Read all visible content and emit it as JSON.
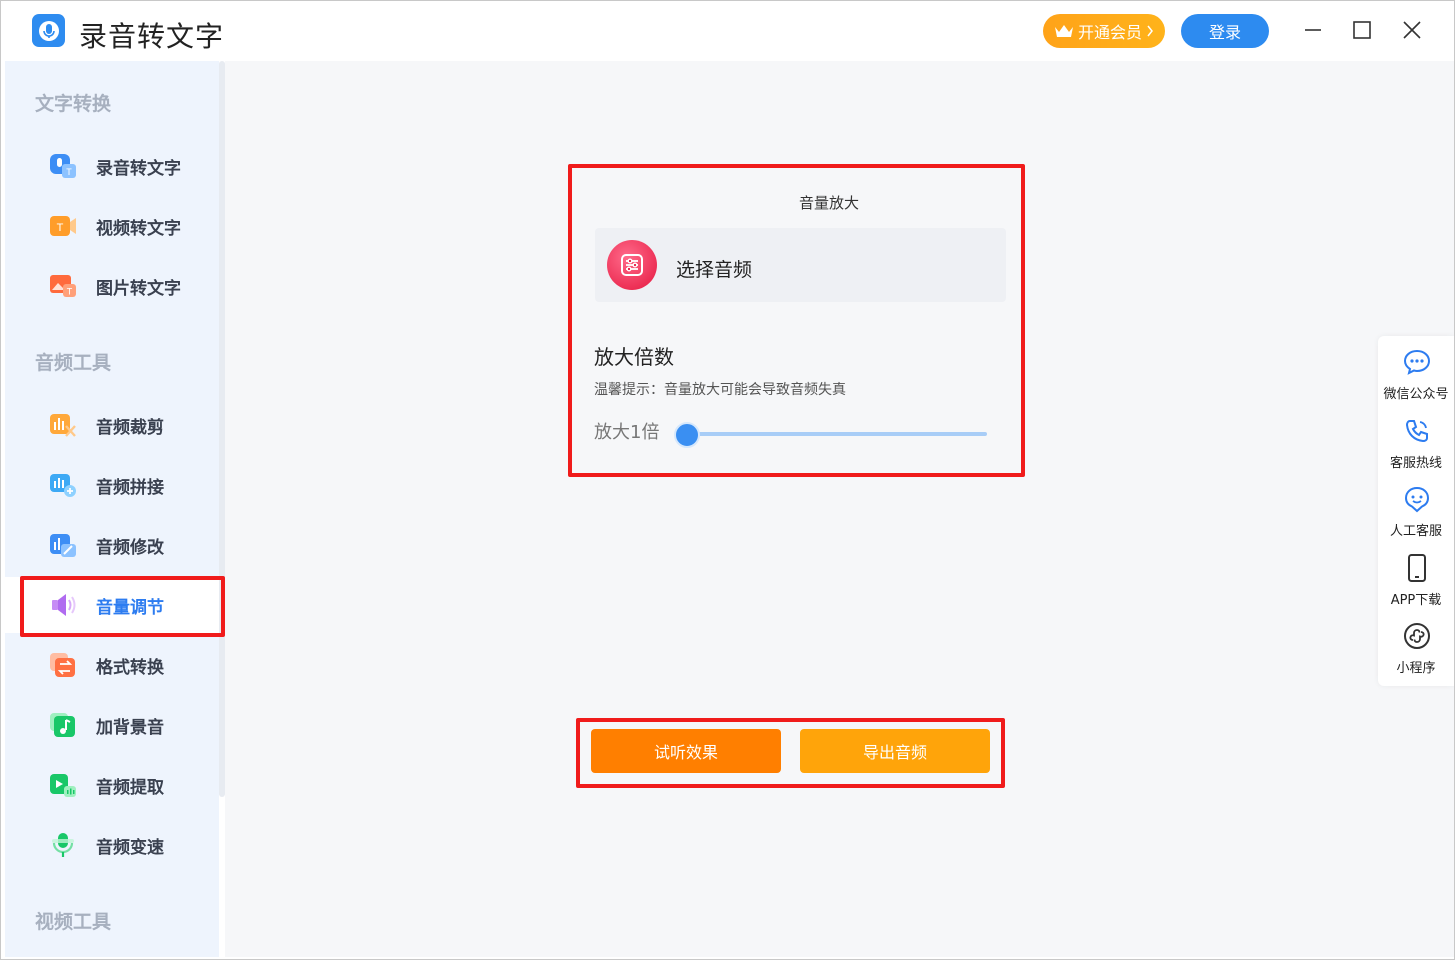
{
  "titlebar": {
    "app_title": "录音转文字",
    "vip_label": "开通会员",
    "login_label": "登录"
  },
  "sidebar": {
    "sections": [
      {
        "title": "文字转换",
        "items": [
          {
            "label": "录音转文字",
            "icon": "audio-to-text-icon"
          },
          {
            "label": "视频转文字",
            "icon": "video-to-text-icon"
          },
          {
            "label": "图片转文字",
            "icon": "image-to-text-icon"
          }
        ]
      },
      {
        "title": "音频工具",
        "items": [
          {
            "label": "音频裁剪",
            "icon": "audio-trim-icon"
          },
          {
            "label": "音频拼接",
            "icon": "audio-join-icon"
          },
          {
            "label": "音频修改",
            "icon": "audio-edit-icon"
          },
          {
            "label": "音量调节",
            "icon": "volume-icon",
            "active": true
          },
          {
            "label": "格式转换",
            "icon": "format-convert-icon"
          },
          {
            "label": "加背景音",
            "icon": "music-note-icon"
          },
          {
            "label": "音频提取",
            "icon": "audio-extract-icon"
          },
          {
            "label": "音频变速",
            "icon": "microphone-icon"
          }
        ]
      },
      {
        "title": "视频工具",
        "items": []
      }
    ]
  },
  "main": {
    "card_title": "音量放大",
    "select_audio_label": "选择音频",
    "amplify_title": "放大倍数",
    "amplify_tip": "温馨提示：音量放大可能会导致音频失真",
    "amplify_value_label": "放大1倍",
    "slider_fraction": 0,
    "preview_button": "试听效果",
    "export_button": "导出音频"
  },
  "right_panel": {
    "items": [
      {
        "label": "微信公众号",
        "icon": "wechat-icon"
      },
      {
        "label": "客服热线",
        "icon": "phone-icon"
      },
      {
        "label": "人工客服",
        "icon": "customer-service-icon"
      },
      {
        "label": "APP下载",
        "icon": "mobile-icon"
      },
      {
        "label": "小程序",
        "icon": "mini-program-icon"
      }
    ]
  },
  "colors": {
    "primary_blue": "#2d8bf0",
    "vip_orange": "#ffa319",
    "button_orange_dark": "#ff7f00",
    "button_orange_light": "#ffa40a",
    "highlight_red": "#f01b1b",
    "sidebar_bg": "#eef4fd"
  }
}
